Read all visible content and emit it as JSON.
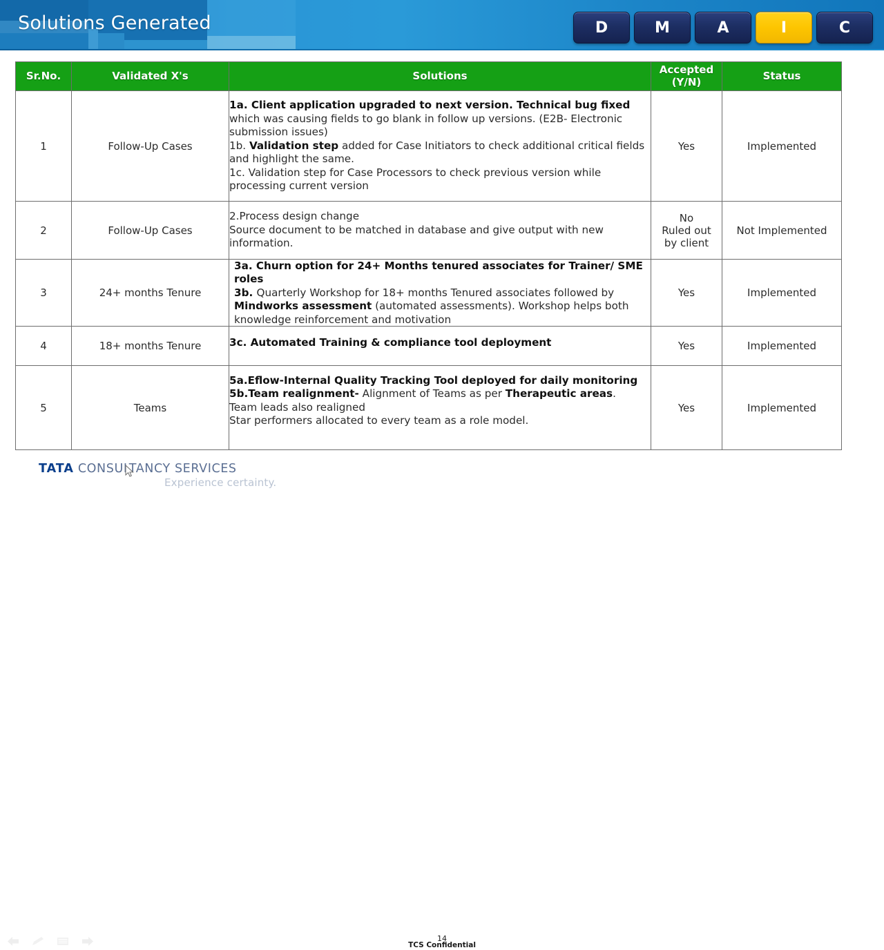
{
  "header": {
    "title": "Solutions Generated",
    "dmaic": [
      {
        "label": "D",
        "active": false
      },
      {
        "label": "M",
        "active": false
      },
      {
        "label": "A",
        "active": false
      },
      {
        "label": "I",
        "active": true
      },
      {
        "label": "C",
        "active": false
      }
    ],
    "accent_blue": "#1a81c6",
    "active_color": "#fdc500"
  },
  "table": {
    "header_color": "#15a015",
    "columns": [
      {
        "key": "sr",
        "label": "Sr.No."
      },
      {
        "key": "vx",
        "label": "Validated X's"
      },
      {
        "key": "sol",
        "label": "Solutions"
      },
      {
        "key": "acc",
        "label_line1": "Accepted",
        "label_line2": "(Y/N)"
      },
      {
        "key": "sta",
        "label": "Status"
      }
    ],
    "rows": [
      {
        "sr": "1",
        "vx": "Follow-Up Cases",
        "solution_lines": [
          {
            "segments": [
              {
                "text": "1a. Client application upgraded to next version. Technical bug fixed",
                "bold": true
              },
              {
                "text": " which was causing fields to go blank in follow up versions. (E2B- Electronic submission issues)",
                "bold": false
              }
            ]
          },
          {
            "segments": [
              {
                "text": "1b. ",
                "bold": false
              },
              {
                "text": "Validation step",
                "bold": true
              },
              {
                "text": " added for Case Initiators to check additional critical fields and highlight the same.",
                "bold": false
              }
            ]
          },
          {
            "segments": [
              {
                "text": "1c. Validation step for Case Processors  to check previous version while processing current version",
                "bold": false
              }
            ]
          }
        ],
        "accepted": "Yes",
        "status": "Implemented"
      },
      {
        "sr": "2",
        "vx": "Follow-Up Cases",
        "solution_lines": [
          {
            "segments": [
              {
                "text": "2.Process design change",
                "bold": false
              }
            ]
          },
          {
            "segments": [
              {
                "text": "Source document to be matched in database and give output with new information.",
                "bold": false
              }
            ]
          }
        ],
        "accepted": "No\nRuled out\nby client",
        "accepted_lines": [
          "No",
          "Ruled out",
          "by client"
        ],
        "status": "Not Implemented"
      },
      {
        "sr": "3",
        "vx": "24+ months Tenure",
        "solution_lines": [
          {
            "segments": [
              {
                "text": "3a. Churn option for 24+ Months tenured associates for Trainer/ SME roles",
                "bold": true
              }
            ]
          },
          {
            "segments": [
              {
                "text": "3b. ",
                "bold": true
              },
              {
                "text": "Quarterly Workshop for 18+ months Tenured associates followed by ",
                "bold": false
              },
              {
                "text": "Mindworks assessment",
                "bold": true
              },
              {
                "text": " (automated assessments). Workshop helps both knowledge reinforcement and motivation",
                "bold": false
              }
            ]
          }
        ],
        "accepted": "Yes",
        "status": "Implemented"
      },
      {
        "sr": "4",
        "vx": "18+ months Tenure",
        "solution_lines": [
          {
            "segments": [
              {
                "text": "3c. Automated Training & compliance tool deployment",
                "bold": true
              }
            ]
          }
        ],
        "accepted": "Yes",
        "status": "Implemented"
      },
      {
        "sr": "5",
        "vx": "Teams",
        "solution_lines": [
          {
            "segments": [
              {
                "text": "5a.Eflow-Internal Quality Tracking Tool deployed for daily monitoring",
                "bold": true
              }
            ]
          },
          {
            "segments": [
              {
                "text": "5b.Team realignment-",
                "bold": true
              },
              {
                "text": " Alignment of Teams as per ",
                "bold": false
              },
              {
                "text": "Therapeutic areas",
                "bold": true
              },
              {
                "text": ".",
                "bold": false
              }
            ]
          },
          {
            "segments": [
              {
                "text": "Team leads also realigned",
                "bold": false
              }
            ]
          },
          {
            "segments": [
              {
                "text": "Star performers allocated to every team as a role model.",
                "bold": false
              }
            ]
          }
        ],
        "accepted": "Yes",
        "status": "Implemented"
      }
    ]
  },
  "footer": {
    "logo_tata": "TATA",
    "logo_rest": "CONSULTANCY SERVICES",
    "tagline": "Experience certainty.",
    "page_number": "14",
    "confidential": "TCS Confidential",
    "nav": [
      {
        "name": "previous-slide",
        "glyph": "←"
      },
      {
        "name": "pen-annotate",
        "glyph": "╱"
      },
      {
        "name": "slide-menu",
        "glyph": "≡"
      },
      {
        "name": "next-slide",
        "glyph": "→"
      }
    ]
  }
}
